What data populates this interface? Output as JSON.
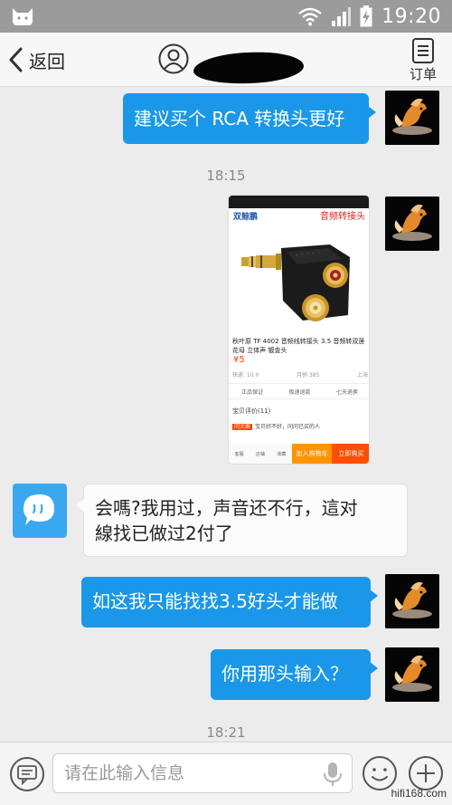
{
  "status_bar": {
    "time": "19:20"
  },
  "nav": {
    "back_label": "返回",
    "orders_label": "订单"
  },
  "messages": [
    {
      "text": "建议买个 RCA 转换头更好"
    },
    {
      "text": "会嗎?我用过，声音还不行，這对",
      "text2": "線找已做过2付了"
    },
    {
      "text": "如这我只能找找3.5好头才能做"
    },
    {
      "text": "你用那头输入？"
    }
  ],
  "timestamps": [
    "18:15",
    "18:21"
  ],
  "product_card": {
    "header_title": "音频转接头",
    "brand": "双鲸鹏",
    "title": "秋叶原 TF 4002 音频线转接头 3.5 音频转双莲花母 立体声 镀金头",
    "price": "¥5",
    "ship_left": "快递: 10.0",
    "ship_mid": "月销 385",
    "ship_right": "上海",
    "tags": [
      "正品保证",
      "极速退款",
      "七天退换"
    ],
    "reviews_label": "宝贝评价(11)",
    "review_tag": "问大家",
    "review_text": "宝贝好不好，问问已买的人",
    "bottom_icons": [
      "客服",
      "店铺",
      "收藏"
    ],
    "cart_label": "加入购物车",
    "buy_label": "立即购买"
  },
  "input": {
    "placeholder": "请在此输入信息"
  },
  "watermark": "hifi168.com",
  "colors": {
    "outgoing_bubble": "#1a97e8",
    "background": "#ececec"
  }
}
